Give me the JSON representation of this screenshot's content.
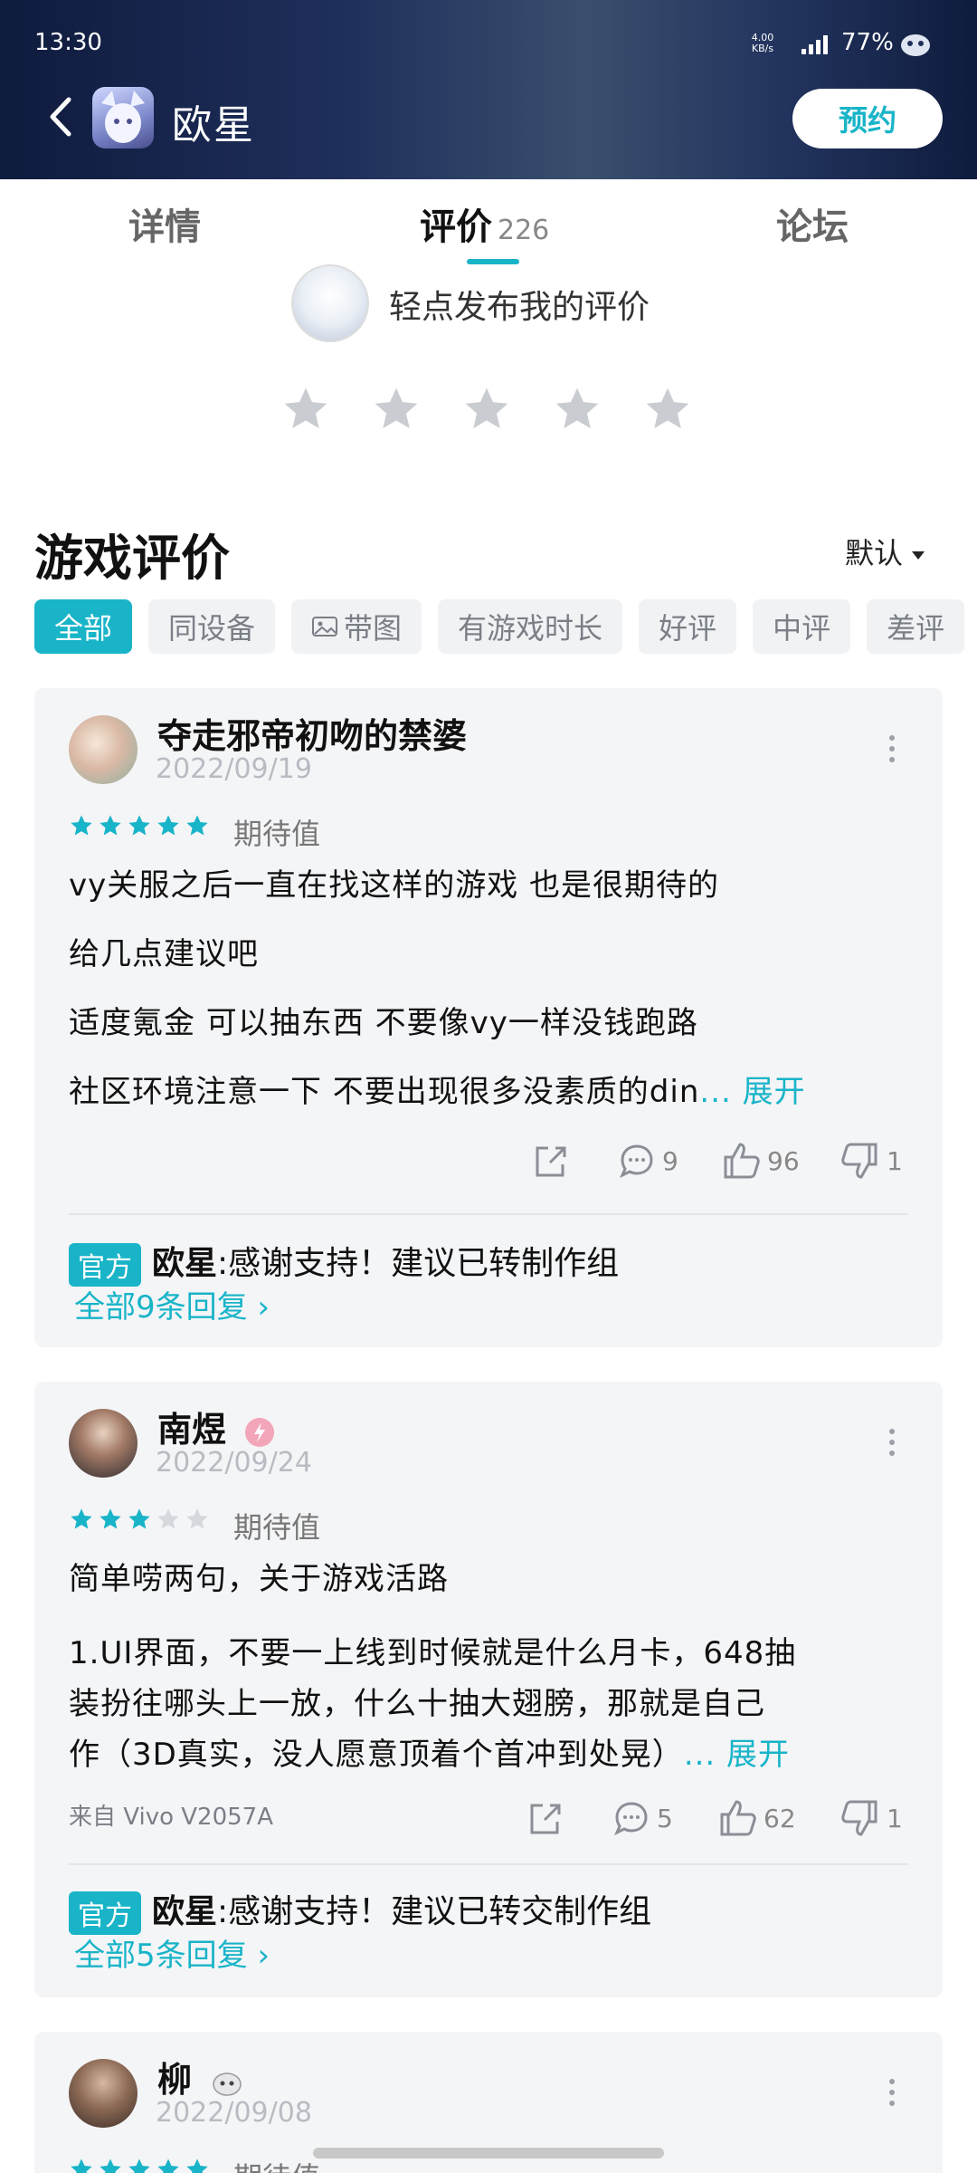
{
  "status_bar": {
    "time": "13:30",
    "net_speed": "4.00\nKB/s",
    "battery": "77%"
  },
  "header": {
    "title": "欧星",
    "reserve_label": "预约"
  },
  "tabs": [
    {
      "label": "详情"
    },
    {
      "label": "评价",
      "count": "226"
    },
    {
      "label": "论坛"
    }
  ],
  "my_review": {
    "prompt": "轻点发布我的评价"
  },
  "section": {
    "title": "游戏评价",
    "sort": "默认"
  },
  "filters": [
    "全部",
    "同设备",
    "带图",
    "有游戏时长",
    "好评",
    "中评",
    "差评"
  ],
  "reviews": [
    {
      "user": "夺走邪帝初吻的禁婆",
      "date": "2022/09/19",
      "rating": 5,
      "tag": "期待值",
      "lines": [
        "vy关服之后一直在找这样的游戏 也是很期待的",
        "给几点建议吧",
        "适度氪金 可以抽东西 不要像vy一样没钱跑路",
        "社区环境注意一下 不要出现很多没素质的din"
      ],
      "expand": "... 展开",
      "comments": "9",
      "likes": "96",
      "dislikes": "1",
      "official_badge": "官方",
      "official_name": "欧星",
      "official_reply": ":感谢支持！建议已转制作组",
      "all_replies": "全部9条回复 ›"
    },
    {
      "user": "南煜",
      "date": "2022/09/24",
      "rating": 3,
      "tag": "期待值",
      "lines": [
        "简单唠两句，关于游戏活路",
        "1.UI界面，不要一上线到时候就是什么月卡，648抽",
        "装扮往哪头上一放，什么十抽大翅膀，那就是自己",
        "作（3D真实，没人愿意顶着个首冲到处晃）"
      ],
      "expand": "... 展开",
      "device": "来自 Vivo V2057A",
      "comments": "5",
      "likes": "62",
      "dislikes": "1",
      "official_badge": "官方",
      "official_name": "欧星",
      "official_reply": ":感谢支持！建议已转交制作组",
      "all_replies": "全部5条回复 ›"
    },
    {
      "user": "柳",
      "date": "2022/09/08",
      "tag": "期待值"
    }
  ],
  "colors": {
    "accent": "#19b4c8",
    "card_bg": "#f4f5f7",
    "star_filled": "#19b4c8",
    "star_empty": "#d5d8dc"
  }
}
